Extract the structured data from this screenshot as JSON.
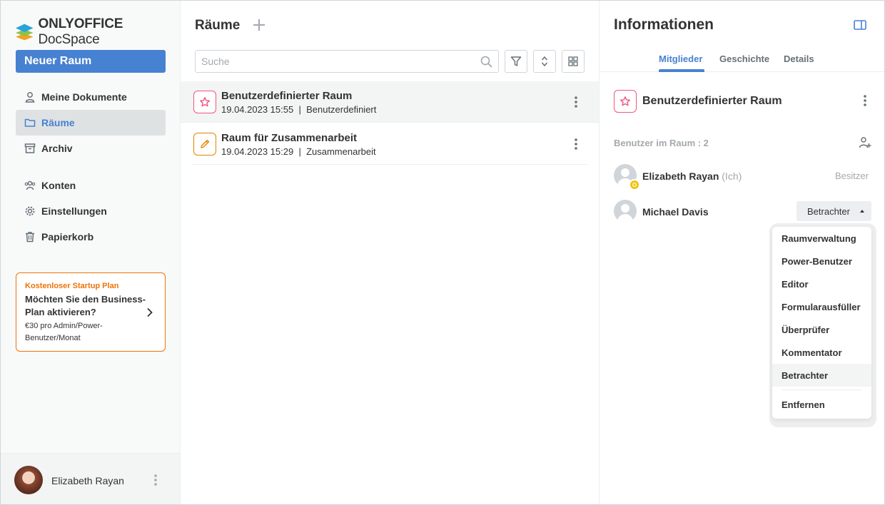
{
  "app": {
    "logo_brand": "ONLYOFFICE",
    "logo_product": "DocSpace"
  },
  "sidebar": {
    "new_room_label": "Neuer Raum",
    "items": [
      {
        "label": "Meine Dokumente"
      },
      {
        "label": "Räume"
      },
      {
        "label": "Archiv"
      },
      {
        "label": "Konten"
      },
      {
        "label": "Einstellungen"
      },
      {
        "label": "Papierkorb"
      }
    ],
    "promo": {
      "header": "Kostenloser Startup Plan",
      "title": "Möchten Sie den Business-Plan aktivieren?",
      "subtitle": "€30 pro Admin/Power-Benutzer/Monat"
    },
    "profile_name": "Elizabeth Rayan"
  },
  "main": {
    "title": "Räume",
    "search_placeholder": "Suche",
    "rooms": [
      {
        "name": "Benutzerdefinierter Raum",
        "date": "19.04.2023 15:55",
        "separator": "|",
        "type": "Benutzerdefiniert",
        "icon": "star-icon"
      },
      {
        "name": "Raum für Zusammenarbeit",
        "date": "19.04.2023 15:29",
        "separator": "|",
        "type": "Zusammenarbeit",
        "icon": "pencil-icon"
      }
    ]
  },
  "info_panel": {
    "title": "Informationen",
    "tabs": [
      {
        "label": "Mitglieder"
      },
      {
        "label": "Geschichte"
      },
      {
        "label": "Details"
      }
    ],
    "room_name": "Benutzerdefinierter Raum",
    "users_in_room_label": "Benutzer im Raum : 2",
    "members": [
      {
        "name": "Elizabeth Rayan",
        "me_label": "(Ich)",
        "role": "Besitzer",
        "badge": "O"
      },
      {
        "name": "Michael Davis",
        "role": "Betrachter"
      }
    ],
    "role_options": [
      {
        "label": "Raumverwaltung"
      },
      {
        "label": "Power-Benutzer"
      },
      {
        "label": "Editor"
      },
      {
        "label": "Formularausfüller"
      },
      {
        "label": "Überprüfer"
      },
      {
        "label": "Kommentator"
      },
      {
        "label": "Betrachter"
      },
      {
        "label": "Entfernen"
      }
    ]
  },
  "colors": {
    "accent": "#4781d1",
    "promo_orange": "#ed7309",
    "room_pink": "#f2557c",
    "room_orange": "#e38300",
    "owner_badge": "#edc409"
  }
}
